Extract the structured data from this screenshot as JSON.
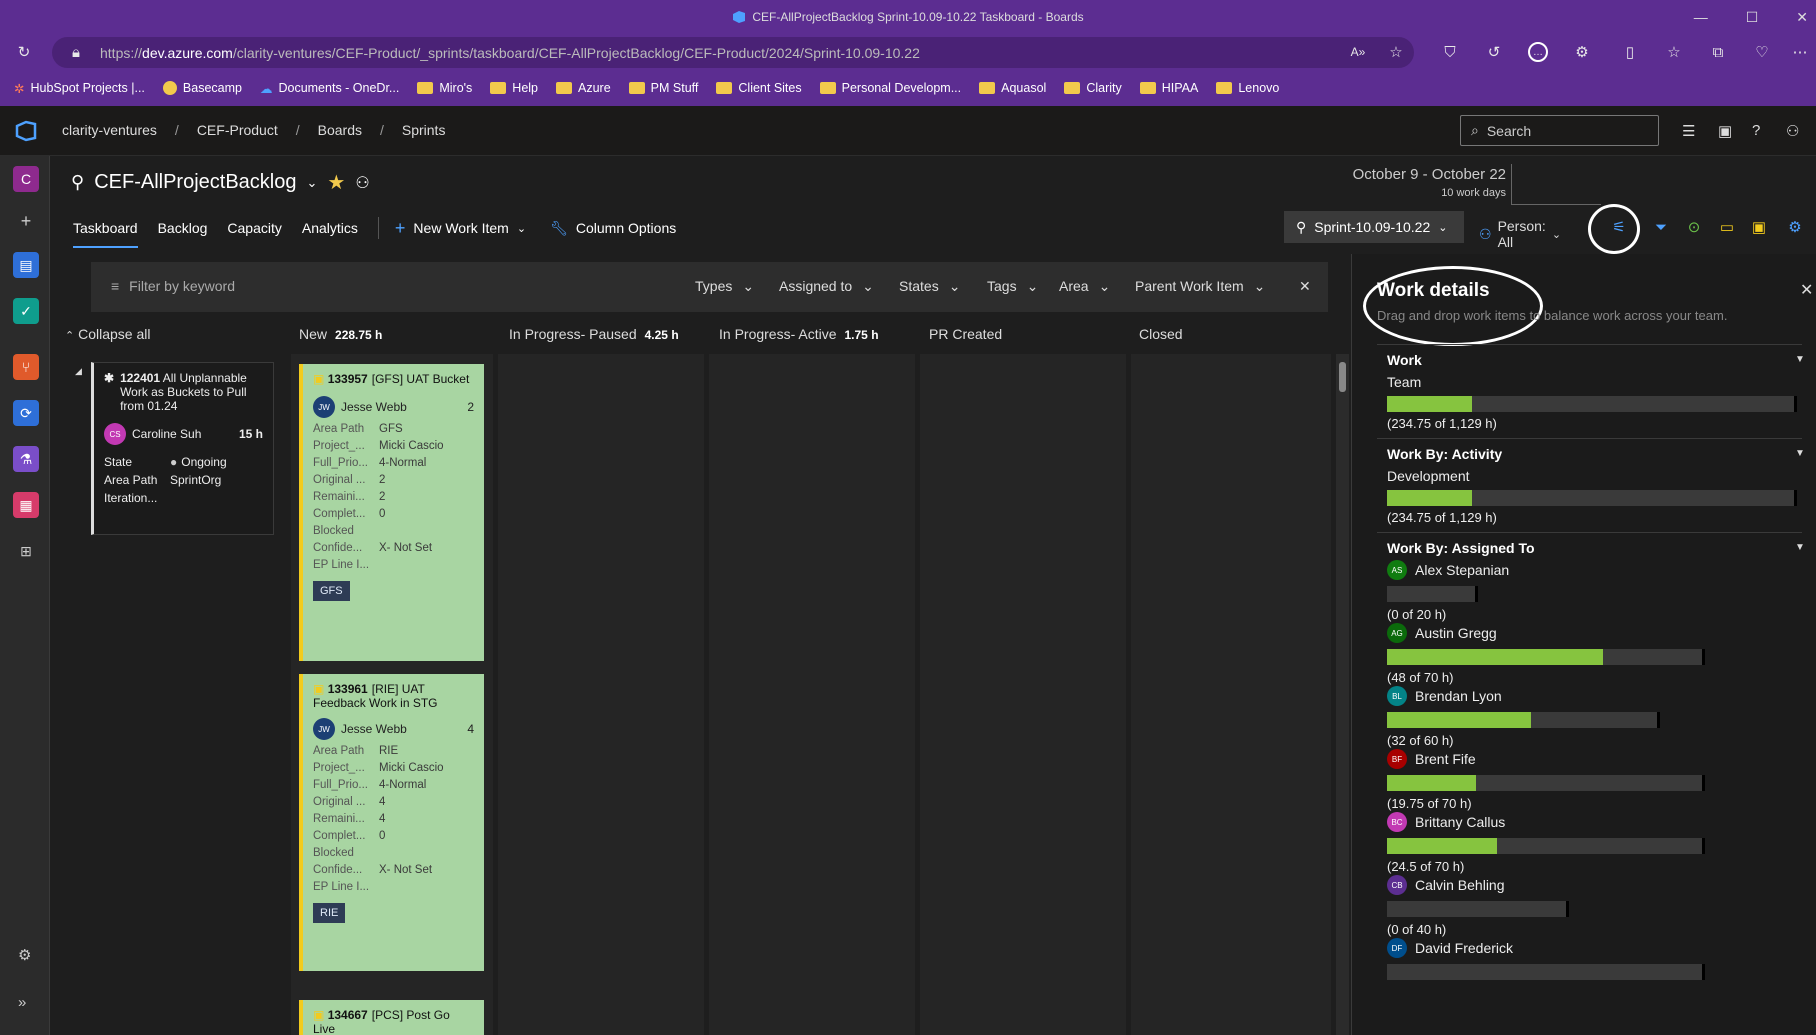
{
  "window": {
    "title": "CEF-AllProjectBacklog Sprint-10.09-10.22 Taskboard - Boards",
    "controls": [
      "—",
      "☐",
      "✕"
    ]
  },
  "address": {
    "prefix": "https://",
    "domain": "dev.azure.com",
    "path": "/clarity-ventures/CEF-Product/_sprints/taskboard/CEF-AllProjectBacklog/CEF-Product/2024/Sprint-10.09-10.22"
  },
  "bookmarks": [
    {
      "label": "HubSpot Projects |...",
      "icon": "hubspot-icon"
    },
    {
      "label": "Basecamp",
      "icon": "basecamp-icon"
    },
    {
      "label": "Documents - OneDr...",
      "icon": "onedrive-icon"
    },
    {
      "label": "Miro's",
      "icon": "folder-icon"
    },
    {
      "label": "Help",
      "icon": "folder-icon"
    },
    {
      "label": "Azure",
      "icon": "folder-icon"
    },
    {
      "label": "PM Stuff",
      "icon": "folder-icon"
    },
    {
      "label": "Client Sites",
      "icon": "folder-icon"
    },
    {
      "label": "Personal Developm...",
      "icon": "folder-icon"
    },
    {
      "label": "Aquasol",
      "icon": "folder-icon"
    },
    {
      "label": "Clarity",
      "icon": "folder-icon"
    },
    {
      "label": "HIPAA",
      "icon": "folder-icon"
    },
    {
      "label": "Lenovo",
      "icon": "folder-icon"
    }
  ],
  "breadcrumb": [
    "clarity-ventures",
    "CEF-Product",
    "Boards",
    "Sprints"
  ],
  "search": {
    "placeholder": "Search"
  },
  "rail": {
    "org_initial": "C"
  },
  "board": {
    "name": "CEF-AllProjectBacklog",
    "date_range": "October 9 - October 22",
    "work_days": "10 work days",
    "pivots": [
      "Taskboard",
      "Backlog",
      "Capacity",
      "Analytics"
    ],
    "new_work_item": "New Work Item",
    "column_options": "Column Options",
    "sprint": "Sprint-10.09-10.22",
    "person": "Person: All"
  },
  "filter": {
    "placeholder": "Filter by keyword",
    "dropdowns": [
      "Types",
      "Assigned to",
      "States",
      "Tags",
      "Area",
      "Parent Work Item"
    ]
  },
  "columns": [
    {
      "name": "New",
      "hours": "228.75 h"
    },
    {
      "name": "In Progress- Paused",
      "hours": "4.25 h"
    },
    {
      "name": "In Progress- Active",
      "hours": "1.75 h"
    },
    {
      "name": "PR Created",
      "hours": ""
    },
    {
      "name": "Closed",
      "hours": ""
    }
  ],
  "collapse_all": "Collapse all",
  "parent_card": {
    "id": "122401",
    "title": "All Unplannable Work as Buckets to Pull from 01.24",
    "assignee": "Caroline Suh",
    "assignee_initials": "CS",
    "hours": "15 h",
    "state_label": "State",
    "state": "Ongoing",
    "area_label": "Area Path",
    "area": "SprintOrg",
    "iteration_label": "Iteration..."
  },
  "cards": [
    {
      "id": "133957",
      "title": "[GFS] UAT Bucket",
      "assignee": "Jesse Webb",
      "initials": "JW",
      "count": "2",
      "fields": [
        {
          "k": "Area Path",
          "v": "GFS"
        },
        {
          "k": "Project_...",
          "v": "Micki Cascio"
        },
        {
          "k": "Full_Prio...",
          "v": "4-Normal"
        },
        {
          "k": "Original ...",
          "v": "2"
        },
        {
          "k": "Remaini...",
          "v": "2"
        },
        {
          "k": "Complet...",
          "v": "0"
        },
        {
          "k": "Blocked",
          "v": ""
        },
        {
          "k": "Confide...",
          "v": "X- Not Set"
        },
        {
          "k": "EP Line I...",
          "v": ""
        }
      ],
      "tag": "GFS"
    },
    {
      "id": "133961",
      "title": "[RIE] UAT Feedback Work in STG",
      "assignee": "Jesse Webb",
      "initials": "JW",
      "count": "4",
      "fields": [
        {
          "k": "Area Path",
          "v": "RIE"
        },
        {
          "k": "Project_...",
          "v": "Micki Cascio"
        },
        {
          "k": "Full_Prio...",
          "v": "4-Normal"
        },
        {
          "k": "Original ...",
          "v": "4"
        },
        {
          "k": "Remaini...",
          "v": "4"
        },
        {
          "k": "Complet...",
          "v": "0"
        },
        {
          "k": "Blocked",
          "v": ""
        },
        {
          "k": "Confide...",
          "v": "X- Not Set"
        },
        {
          "k": "EP Line I...",
          "v": ""
        }
      ],
      "tag": "RIE"
    },
    {
      "id": "134667",
      "title": "[PCS] Post Go Live"
    }
  ],
  "work_details": {
    "title": "Work details",
    "subtitle": "Drag and drop work items to balance work across your team.",
    "work": {
      "heading": "Work",
      "label": "Team",
      "value": "(234.75 of 1,129 h)",
      "fraction": 0.2079
    },
    "activity": {
      "heading": "Work By: Activity",
      "label": "Development",
      "value": "(234.75 of 1,129 h)",
      "fraction": 0.2079
    },
    "assigned": {
      "heading": "Work By: Assigned To",
      "people": [
        {
          "name": "Alex Stepanian",
          "initials": "AS",
          "color": "#107c10",
          "value": "(0 of 20 h)",
          "fraction": 0,
          "capacity": 20
        },
        {
          "name": "Austin Gregg",
          "initials": "AG",
          "color": "#0b6a0b",
          "value": "(48 of 70 h)",
          "fraction": 0.686,
          "capacity": 70
        },
        {
          "name": "Brendan Lyon",
          "initials": "BL",
          "color": "#038387",
          "value": "(32 of 60 h)",
          "fraction": 0.533,
          "capacity": 60
        },
        {
          "name": "Brent Fife",
          "initials": "BF",
          "color": "#a80000",
          "value": "(19.75 of 70 h)",
          "fraction": 0.282,
          "capacity": 70
        },
        {
          "name": "Brittany Callus",
          "initials": "BC",
          "color": "#c239b3",
          "value": "(24.5 of 70 h)",
          "fraction": 0.35,
          "capacity": 70
        },
        {
          "name": "Calvin Behling",
          "initials": "CB",
          "color": "#5c2e91",
          "value": "(0 of 40 h)",
          "fraction": 0,
          "capacity": 40
        },
        {
          "name": "David Frederick",
          "initials": "DF",
          "color": "#004e8c",
          "value": "",
          "fraction": 0,
          "capacity": 70
        }
      ]
    }
  },
  "colors": {
    "accent": "#4ea1ff",
    "bar_fill": "#86c43f",
    "card_bg": "#a8d5a2",
    "chrome": "#5c2d91"
  }
}
